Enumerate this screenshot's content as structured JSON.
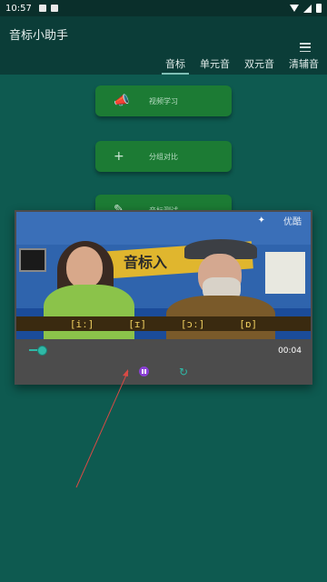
{
  "status_bar": {
    "time": "10:57"
  },
  "app": {
    "title": "音标小助手"
  },
  "tabs": [
    {
      "label": "音标",
      "active": true
    },
    {
      "label": "单元音",
      "active": false
    },
    {
      "label": "双元音",
      "active": false
    },
    {
      "label": "清辅音",
      "active": false
    }
  ],
  "menu_buttons": [
    {
      "label": "视频学习",
      "icon": "megaphone-icon"
    },
    {
      "label": "分组对比",
      "icon": "plus-icon"
    },
    {
      "label": "音标测试",
      "icon": "edit-icon"
    }
  ],
  "video": {
    "sign_text": "音标入",
    "phonetics": [
      "[iː]",
      "[ɪ]",
      "[ɔː]",
      "[ɒ]"
    ],
    "logo": "优酷"
  },
  "player": {
    "current_time": "00:04",
    "progress": 0.03
  },
  "colors": {
    "background": "#0e5a50",
    "app_bar": "#0b3d38",
    "button": "#1c7b34",
    "accent": "#2fb8a6",
    "pause": "#8a3fd6",
    "dialog": "#4c4c4c"
  }
}
